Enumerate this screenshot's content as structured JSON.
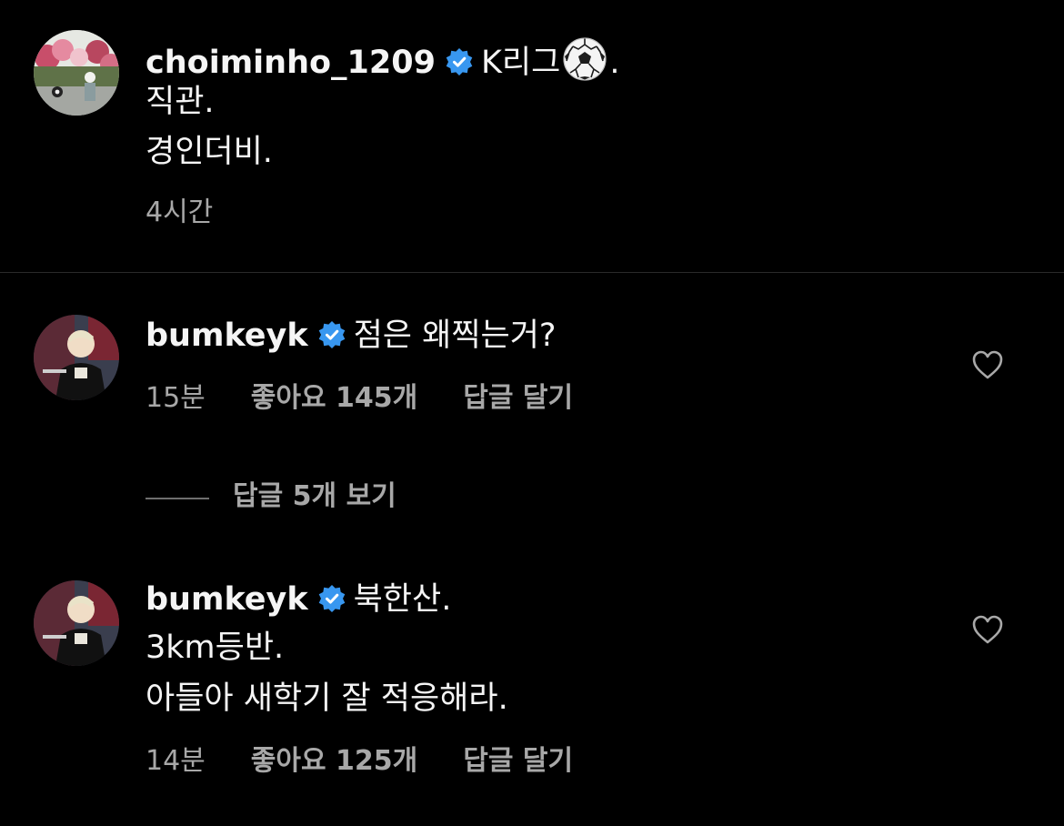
{
  "comments": [
    {
      "username": "choiminho_1209",
      "lines": [
        "K리그",
        ".",
        "직관.",
        "경인더비."
      ],
      "time": "4시간"
    },
    {
      "username": "bumkeyk",
      "lines": [
        "점은 왜찍는거?"
      ],
      "time": "15분",
      "likes": "좋아요 145개",
      "reply": "답글 달기",
      "view_replies": "답글 5개 보기"
    },
    {
      "username": "bumkeyk",
      "lines": [
        "북한산.",
        "3km등반.",
        "아들아 새학기 잘 적응해라."
      ],
      "time": "14분",
      "likes": "좋아요 125개",
      "reply": "답글 달기"
    }
  ],
  "icons": {
    "verified": "verified-badge-icon",
    "soccer": "soccer-ball-emoji",
    "heart": "heart-outline-icon"
  },
  "colors": {
    "background": "#000000",
    "text": "#f5f5f5",
    "secondary_text": "#a8a8a8",
    "verified_blue": "#3897f0",
    "divider": "#2a2a2a"
  }
}
